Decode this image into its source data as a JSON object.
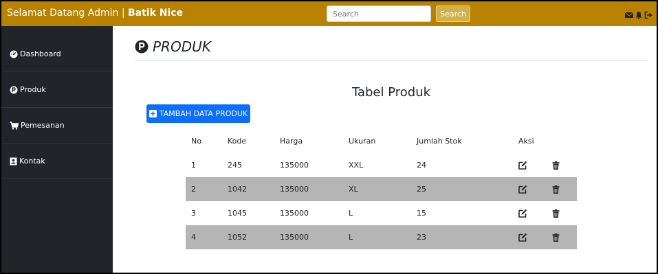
{
  "header": {
    "welcome_text": "Selamat Datang Admin | ",
    "brand_name": "Batik Nice",
    "search_placeholder": "Search",
    "search_button": "Search",
    "icons": [
      "envelope-icon",
      "bell-icon",
      "sign-out-icon"
    ]
  },
  "sidebar": {
    "items": [
      {
        "label": "Dashboard",
        "icon": "dashboard-icon"
      },
      {
        "label": "Produk",
        "icon": "product-p-icon"
      },
      {
        "label": "Pemesanan",
        "icon": "cart-icon"
      },
      {
        "label": "Kontak",
        "icon": "address-book-icon"
      }
    ]
  },
  "main": {
    "page_title": "PRODUK",
    "table_title": "Tabel Produk",
    "add_button": "TAMBAH DATA PRODUK",
    "table": {
      "headers": [
        "No",
        "Kode",
        "Harga",
        "Ukuran",
        "Jumlah Stok",
        "Aksi"
      ],
      "rows": [
        {
          "no": "1",
          "kode": "245",
          "harga": "135000",
          "ukuran": "XXL",
          "stok": "24"
        },
        {
          "no": "2",
          "kode": "1042",
          "harga": "135000",
          "ukuran": "XL",
          "stok": "25"
        },
        {
          "no": "3",
          "kode": "1045",
          "harga": "135000",
          "ukuran": "L",
          "stok": "15"
        },
        {
          "no": "4",
          "kode": "1052",
          "harga": "135000",
          "ukuran": "L",
          "stok": "23"
        }
      ]
    }
  },
  "colors": {
    "topbar": "#b88100",
    "sidebar": "#212529",
    "primary_button": "#0d6efd",
    "shaded_row": "#b5b5b5"
  }
}
